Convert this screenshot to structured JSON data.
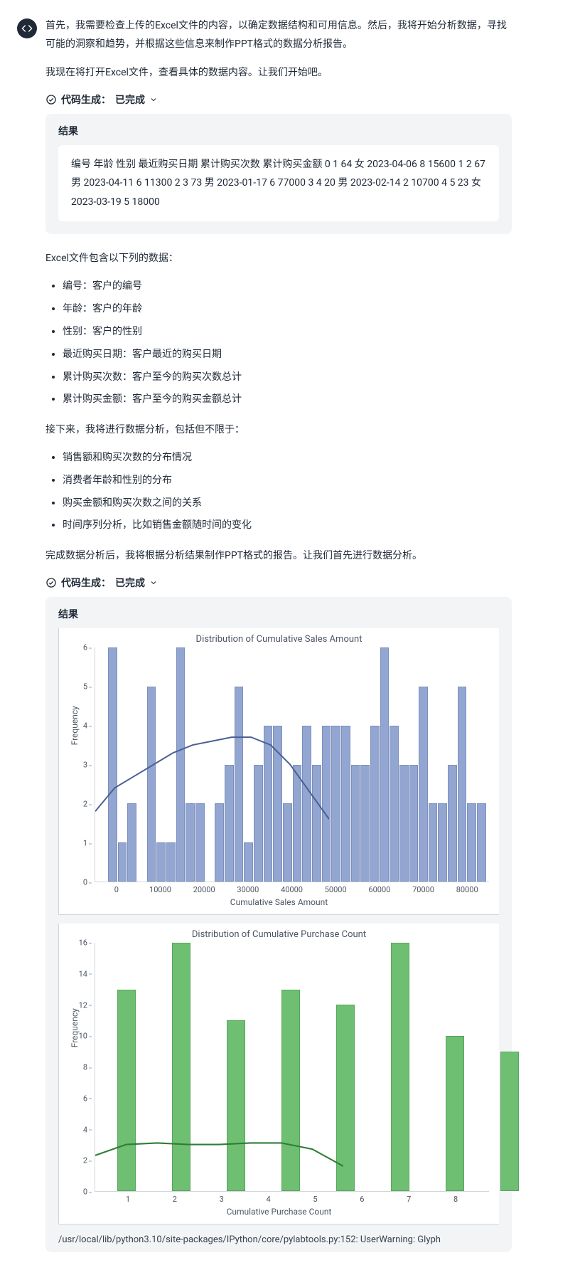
{
  "avatar_icon": "code-brackets",
  "messages": {
    "intro1": "首先，我需要检查上传的Excel文件的内容，以确定数据结构和可用信息。然后，我将开始分析数据，寻找可能的洞察和趋势，并根据这些信息来制作PPT格式的数据分析报告。",
    "intro2": "我现在将打开Excel文件，查看具体的数据内容。让我们开始吧。",
    "excel_contains": "Excel文件包含以下列的数据：",
    "next_steps": "接下来，我将进行数据分析，包括但不限于：",
    "after_analysis": "完成数据分析后，我将根据分析结果制作PPT格式的报告。让我们首先进行数据分析。"
  },
  "code_status": {
    "prefix": "代码生成：",
    "state": "已完成"
  },
  "result": {
    "label": "结果",
    "text1": "编号 年龄 性别 最近购买日期 累计购买次数 累计购买金额 0 1 64 女 2023-04-06 8 15600 1 2 67 男 2023-04-11 6 11300 2 3 73 男 2023-01-17 6 77000 3 4 20 男 2023-02-14 2 10700 4 5 23 女 2023-03-19 5 18000"
  },
  "columns_list": [
    "编号：客户的编号",
    "年龄：客户的年龄",
    "性别：客户的性别",
    "最近购买日期：客户最近的购买日期",
    "累计购买次数：客户至今的购买次数总计",
    "累计购买金额：客户至今的购买金额总计"
  ],
  "analysis_list": [
    "销售额和购买次数的分布情况",
    "消费者年龄和性别的分布",
    "购买金额和购买次数之间的关系",
    "时间序列分析，比如销售金额随时间的变化"
  ],
  "warning_text": "/usr/local/lib/python3.10/site-packages/IPython/core/pylabtools.py:152: UserWarning: Glyph",
  "chart_data": [
    {
      "type": "bar",
      "title": "Distribution of Cumulative Sales Amount",
      "xlabel": "Cumulative Sales Amount",
      "ylabel": "Frequency",
      "ylim": [
        0,
        6
      ],
      "xlim": [
        0,
        80000
      ],
      "x_ticks": [
        "0",
        "10000",
        "20000",
        "30000",
        "40000",
        "50000",
        "60000",
        "70000",
        "80000"
      ],
      "y_ticks": [
        "0",
        "1",
        "2",
        "3",
        "4",
        "5",
        "6"
      ],
      "values": [
        0,
        6,
        1,
        2,
        0,
        5,
        1,
        1,
        6,
        2,
        2,
        0,
        2,
        3,
        5,
        1,
        3,
        4,
        4,
        2,
        3,
        4,
        3,
        4,
        4,
        4,
        3,
        3,
        4,
        6,
        4,
        3,
        3,
        5,
        2,
        2,
        3,
        5,
        2,
        2
      ],
      "kde_approx": [
        1.8,
        2.4,
        2.7,
        3.0,
        3.3,
        3.5,
        3.6,
        3.7,
        3.7,
        3.5,
        3.0,
        2.3,
        1.6
      ]
    },
    {
      "type": "bar",
      "title": "Distribution of Cumulative Purchase Count",
      "xlabel": "Cumulative Purchase Count",
      "ylabel": "Frequency",
      "ylim": [
        0,
        16
      ],
      "categories": [
        "1",
        "2",
        "3",
        "4",
        "5",
        "6",
        "7",
        "8"
      ],
      "values": [
        13,
        16,
        11,
        13,
        12,
        16,
        10,
        9
      ],
      "kde_approx": [
        2.3,
        3.0,
        3.1,
        3.0,
        3.0,
        3.1,
        3.1,
        2.7,
        1.6
      ]
    }
  ]
}
